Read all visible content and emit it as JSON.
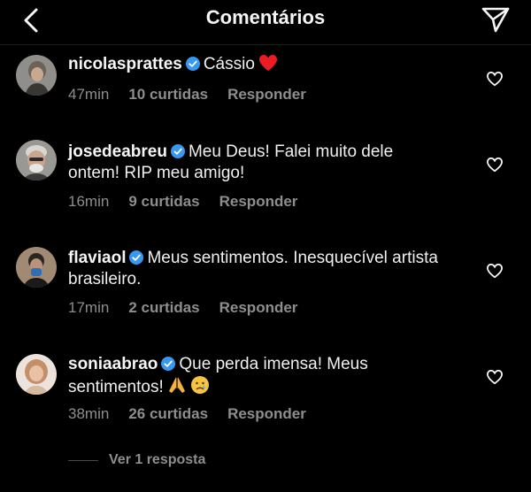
{
  "header": {
    "title": "Comentários",
    "back_icon": "chevron-left-icon",
    "send_icon": "paper-plane-icon"
  },
  "comments": [
    {
      "username": "nicolasprattes",
      "verified": true,
      "text": "Cássio",
      "emoji": "red-heart",
      "time": "47min",
      "likes": "10 curtidas",
      "reply": "Responder"
    },
    {
      "username": "josedeabreu",
      "verified": true,
      "text": "Meu Deus! Falei muito dele ontem! RIP meu amigo!",
      "time": "16min",
      "likes": "9 curtidas",
      "reply": "Responder"
    },
    {
      "username": "flaviaol",
      "verified": true,
      "text": "Meus sentimentos. Inesquecível artista brasileiro.",
      "time": "17min",
      "likes": "2 curtidas",
      "reply": "Responder"
    },
    {
      "username": "soniaabrao",
      "verified": true,
      "text": "Que perda imensa! Meus sentimentos!",
      "emoji": "pray-cry",
      "time": "38min",
      "likes": "26 curtidas",
      "reply": "Responder"
    }
  ],
  "view_replies": "Ver 1 resposta",
  "colors": {
    "background": "#000000",
    "text": "#f5f5f5",
    "meta": "#8e8e8e",
    "verified": "#3897f0",
    "heart_red": "#ed1c24"
  }
}
